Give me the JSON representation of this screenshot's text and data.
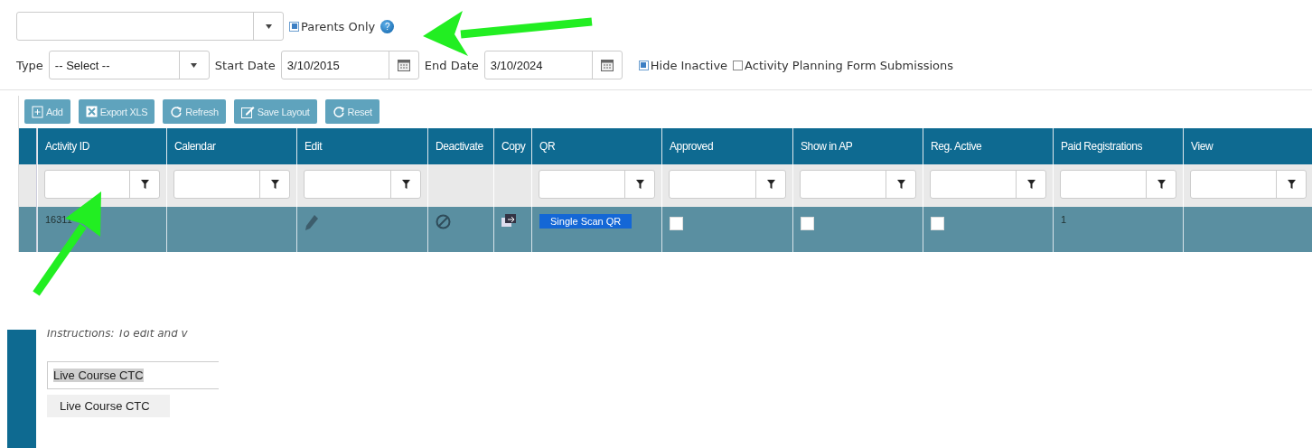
{
  "filters": {
    "parents_only": {
      "label": "Parents Only",
      "checked": true,
      "help": "?"
    },
    "type": {
      "label": "Type",
      "value": "-- Select --"
    },
    "start_date": {
      "label": "Start Date",
      "value": "3/10/2015"
    },
    "end_date": {
      "label": "End Date",
      "value": "3/10/2024"
    },
    "checkboxes": [
      {
        "label": "Hide Inactive",
        "checked": true
      },
      {
        "label": "Activity Planning Form Submissions",
        "checked": false
      }
    ]
  },
  "toolbar": [
    {
      "label": "Add"
    },
    {
      "label": "Export XLS"
    },
    {
      "label": "Refresh"
    },
    {
      "label": "Save Layout"
    },
    {
      "label": "Reset"
    }
  ],
  "table": {
    "columns": [
      {
        "label": "Activity ID",
        "filter": true
      },
      {
        "label": "Calendar",
        "filter": true
      },
      {
        "label": "Edit",
        "filter": true
      },
      {
        "label": "Deactivate",
        "filter": false
      },
      {
        "label": "Copy",
        "filter": false
      },
      {
        "label": "QR",
        "filter": true
      },
      {
        "label": "Approved",
        "filter": true
      },
      {
        "label": "Show in AP",
        "filter": true
      },
      {
        "label": "Reg. Active",
        "filter": true
      },
      {
        "label": "Paid Registrations",
        "filter": true
      },
      {
        "label": "View",
        "filter": true
      }
    ],
    "rows": [
      {
        "cells": [
          {
            "kind": "text",
            "text": "16311"
          },
          {
            "kind": "text",
            "text": ""
          },
          {
            "kind": "edit"
          },
          {
            "kind": "deactivate"
          },
          {
            "kind": "copy"
          },
          {
            "kind": "button",
            "text": "Single Scan QR"
          },
          {
            "kind": "checkbox",
            "checked": false
          },
          {
            "kind": "checkbox",
            "checked": false
          },
          {
            "kind": "checkbox",
            "checked": false
          },
          {
            "kind": "text",
            "text": "1"
          },
          {
            "kind": "text",
            "text": ""
          }
        ]
      }
    ]
  },
  "inset": {
    "instructions": "Instructions: To edit and v",
    "course_field": {
      "value": "Live Course CTC"
    },
    "dropdown": [
      {
        "label": "Live Course CTC",
        "selected": true
      }
    ]
  }
}
